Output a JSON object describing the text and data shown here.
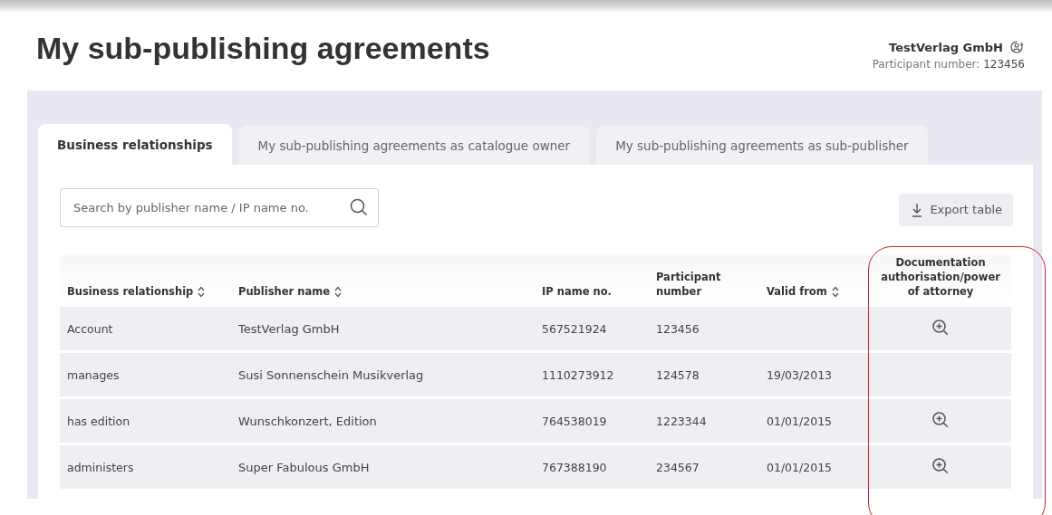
{
  "page": {
    "title": "My sub-publishing agreements"
  },
  "account": {
    "name": "TestVerlag GmbH",
    "participant_label": "Participant number:",
    "participant_number": "123456"
  },
  "tabs": [
    {
      "label": "Business relationships",
      "selected": true
    },
    {
      "label": "My sub-publishing agreements as catalogue owner",
      "selected": false
    },
    {
      "label": "My sub-publishing agreements as sub-publisher",
      "selected": false
    }
  ],
  "search": {
    "placeholder": "Search by publisher name / IP name no."
  },
  "export_button": {
    "label": "Export table"
  },
  "table": {
    "columns": [
      {
        "label": "Business relationship",
        "sortable": true
      },
      {
        "label": "Publisher name",
        "sortable": true
      },
      {
        "label": "IP name no.",
        "sortable": false
      },
      {
        "label": "Participant number",
        "sortable": false
      },
      {
        "label": "Valid from",
        "sortable": true
      },
      {
        "label": "Documentation authorisation/power of attorney",
        "sortable": false,
        "highlighted": true
      }
    ],
    "rows": [
      {
        "relationship": "Account",
        "publisher": "TestVerlag GmbH",
        "ip_name_no": "567521924",
        "participant_number": "123456",
        "has_document": true
      },
      {
        "relationship": "manages",
        "publisher": "Susi Sonnenschein Musikverlag",
        "ip_name_no": "1110273912",
        "participant_number": "124578",
        "valid_from": "19/03/2013",
        "has_document": false
      },
      {
        "relationship": "has edition",
        "publisher": "Wunschkonzert, Edition",
        "ip_name_no": "764538019",
        "participant_number": "1223344",
        "valid_from": "01/01/2015",
        "has_document": true
      },
      {
        "relationship": "administers",
        "publisher": "Super Fabulous GmbH",
        "ip_name_no": "767388190",
        "participant_number": "234567",
        "valid_from": "01/01/2015",
        "has_document": true
      }
    ]
  }
}
